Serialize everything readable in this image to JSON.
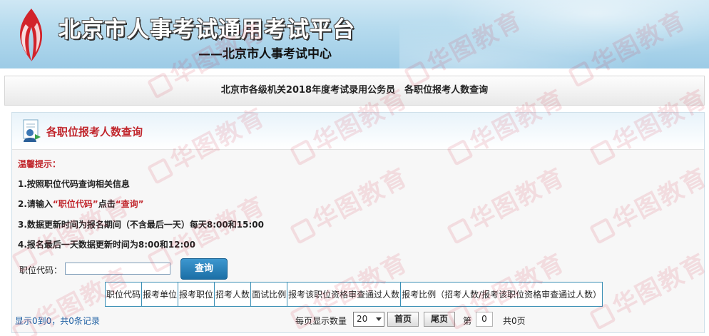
{
  "header": {
    "title": "北京市人事考试通用考试平台",
    "subtitle": "——北京市人事考试中心"
  },
  "titlebar": {
    "text": "北京市各级机关2018年度考试录用公务员　各职位报考人数查询"
  },
  "panel": {
    "title": "各职位报考人数查询"
  },
  "tips": {
    "heading": "温馨提示：",
    "tip1": "1.按照职位代码查询相关信息",
    "tip2_prefix": "2.请输入",
    "tip2_field": "“职位代码”",
    "tip2_mid": "点击",
    "tip2_action": "“查询”",
    "tip3": "3.数据更新时间为报名期间（不含最后一天）每天8:00和15:00",
    "tip4": "4.报名最后一天数据更新时间为8:00和12:00"
  },
  "search": {
    "label": "职位代码：",
    "value": "",
    "button": "查询"
  },
  "table": {
    "columns": [
      "职位代码",
      "报考单位",
      "报考职位",
      "招考人数",
      "面试比例",
      "报考该职位资格审查通过人数",
      "报考比例（招考人数/报考该职位资格审查通过人数）"
    ],
    "rows": []
  },
  "pagination": {
    "summary": "显示0到0，共0条记录",
    "per_page_label": "每页显示数量",
    "per_page_value": "20",
    "first_label": "首页",
    "last_label": "尾页",
    "page_prefix": "第",
    "page_value": "0",
    "page_suffix": "共0页"
  },
  "watermark": {
    "text": "华图教育"
  },
  "colors": {
    "accent_red": "#c1272d",
    "button_blue": "#1b6fa6",
    "table_border": "#3a8fb5",
    "link_blue": "#1d5fa3"
  }
}
